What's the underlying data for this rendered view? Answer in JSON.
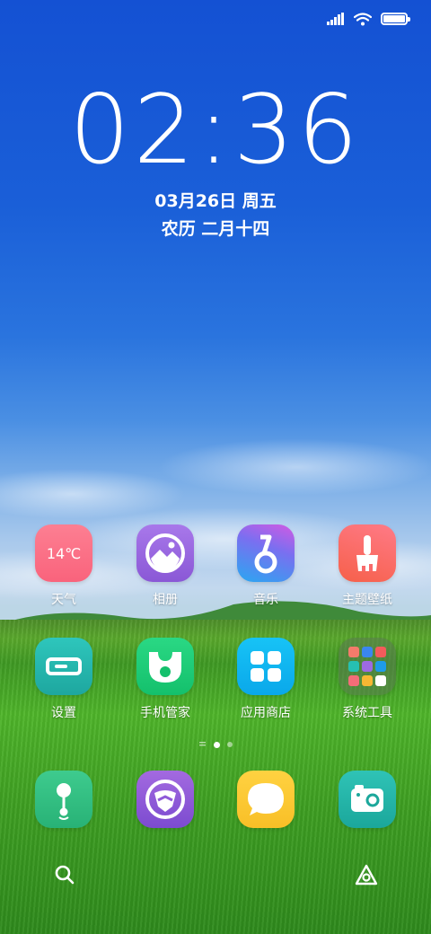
{
  "status": {
    "battery_level": 1.0
  },
  "lockclock": {
    "time": "02:36",
    "date": "03月26日 周五",
    "lunar": "农历 二月十四"
  },
  "row1": [
    {
      "label": "天气",
      "icon_text": "14℃",
      "icon": "weather-icon"
    },
    {
      "label": "相册",
      "icon": "gallery-icon"
    },
    {
      "label": "音乐",
      "icon": "music-icon"
    },
    {
      "label": "主题壁纸",
      "icon": "themes-icon"
    }
  ],
  "row2": [
    {
      "label": "设置",
      "icon": "settings-icon"
    },
    {
      "label": "手机管家",
      "icon": "security-icon"
    },
    {
      "label": "应用商店",
      "icon": "app-store-icon"
    },
    {
      "label": "系统工具",
      "icon": "folder-icon"
    }
  ],
  "dock": [
    {
      "icon": "phone-icon"
    },
    {
      "icon": "browser-icon"
    },
    {
      "icon": "messages-icon"
    },
    {
      "icon": "camera-icon"
    }
  ],
  "page_indicator": {
    "pages": 2,
    "current": 1
  },
  "bottom": {
    "left_icon": "search-icon",
    "right_icon": "assistant-icon"
  },
  "colors": {
    "weather": "#fb6f86",
    "gallery": "#9a6ae0",
    "music": "#3a8ff0",
    "themes": "#f86b6b",
    "settings": "#25b5ae",
    "security": "#1fce78",
    "appstore": "#10b8f0",
    "phone": "#33bd83",
    "browser": "#8f5ad8",
    "messages": "#fcc733",
    "camera": "#22b5a8"
  }
}
